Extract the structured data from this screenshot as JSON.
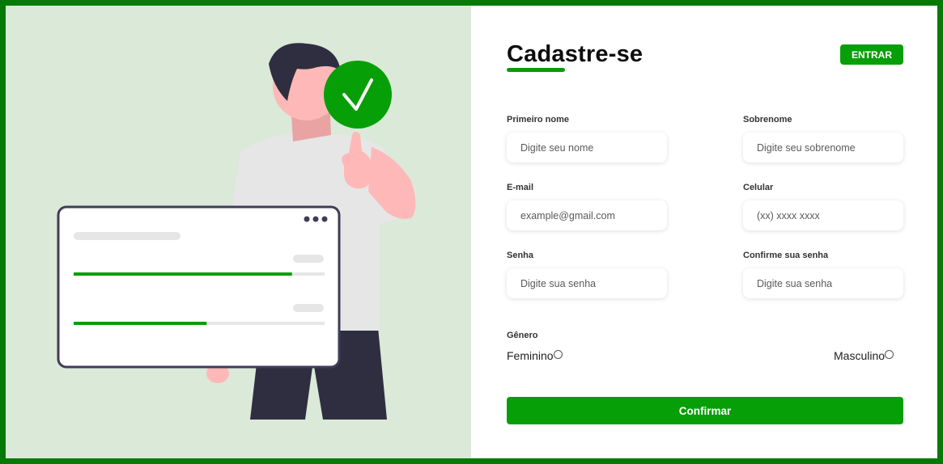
{
  "form": {
    "title": "Cadastre-se",
    "login_button": "ENTRAR",
    "fields": {
      "first_name": {
        "label": "Primeiro nome",
        "placeholder": "Digite seu nome",
        "value": ""
      },
      "last_name": {
        "label": "Sobrenome",
        "placeholder": "Digite seu sobrenome",
        "value": ""
      },
      "email": {
        "label": "E-mail",
        "placeholder": "example@gmail.com",
        "value": ""
      },
      "phone": {
        "label": "Celular",
        "placeholder": "(xx) xxxx xxxx",
        "value": ""
      },
      "password": {
        "label": "Senha",
        "placeholder": "Digite sua senha",
        "value": ""
      },
      "confirm_password": {
        "label": "Confirme sua senha",
        "placeholder": "Digite sua senha",
        "value": ""
      }
    },
    "gender": {
      "label": "Gênero",
      "options": [
        "Feminino",
        "Masculino"
      ],
      "selected": null
    },
    "submit_label": "Confirmar"
  },
  "illustration": {
    "progress_bars": [
      0.87,
      0.53
    ]
  },
  "colors": {
    "accent": "#079f07",
    "page_border": "#067a06",
    "left_panel_bg": "#dbe9d8",
    "person_skin": "#feb8b8",
    "person_hair": "#2f2e41",
    "shirt": "#e6e6e6"
  }
}
